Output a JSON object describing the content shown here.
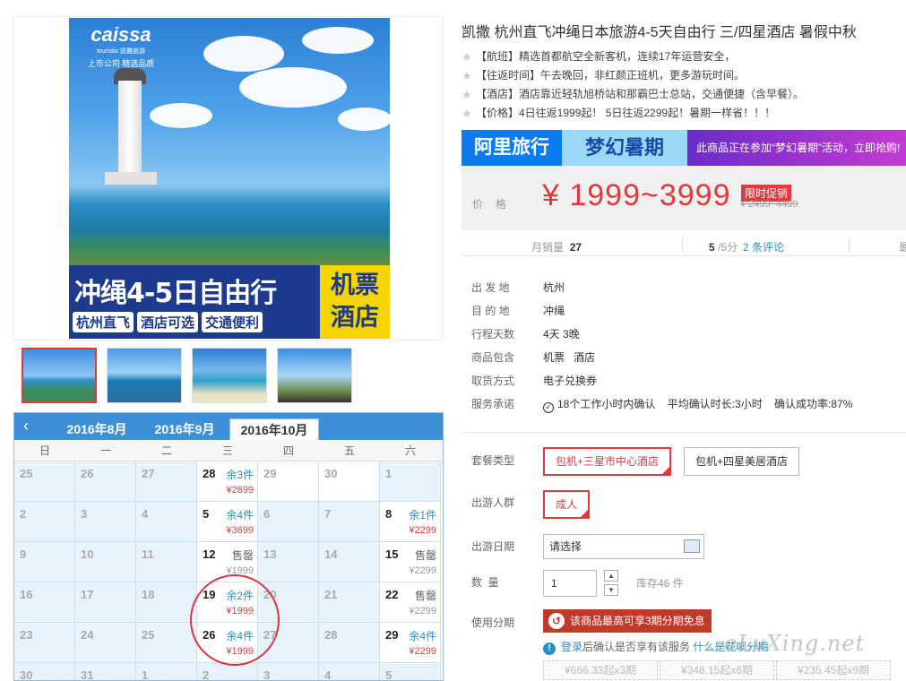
{
  "product": {
    "title": "凯撒 杭州直飞冲绳日本旅游4-5天自由行 三/四星酒店 暑假中秋",
    "features": [
      "【航班】精选首都航空全新客机，连续17年运营安全，",
      "【往返时间】午去晚回，非红颜正班机，更多游玩时间。",
      "【酒店】酒店靠近轻轨旭桥站和那霸巴士总站，交通便捷（含早餐）。",
      "【价格】4日往返1999起！ 5日往返2299起！暑期一样省！！！"
    ]
  },
  "poster": {
    "brand": "caissa",
    "brand_sub": "touristic 凯撒旅游",
    "slogan": "上市公司 精选品质",
    "title": "冲绳4-5日自由行",
    "chips": [
      "杭州直飞",
      "酒店可选",
      "交通便利"
    ],
    "side_line1": "机票",
    "side_line2": "酒店"
  },
  "banner": {
    "brand": "阿里旅行",
    "campaign": "梦幻暑期",
    "promo_text": "此商品正在参加“梦幻暑期”活动，立即抢购!"
  },
  "price": {
    "label": "价格",
    "value": "¥ 1999~3999",
    "badge": "限时促销",
    "original": "¥ 2499~4499"
  },
  "stats": {
    "sales_label": "月销量",
    "sales_value": "27",
    "score_value": "5",
    "score_suffix": "/5分",
    "reviews": "2 条评论",
    "more": "最"
  },
  "info": [
    {
      "k": "出 发 地",
      "v": "杭州"
    },
    {
      "k": "目 的 地",
      "v": "冲绳"
    },
    {
      "k": "行程天数",
      "v": "4天 3晚"
    },
    {
      "k": "商品包含",
      "v": "机票   酒店"
    },
    {
      "k": "取货方式",
      "v": "电子兑换券"
    },
    {
      "k": "服务承诺",
      "v": "18个工作小时内确认    平均确认时长:3小时    确认成功率:87%"
    }
  ],
  "options": {
    "package_label": "套餐类型",
    "package_1": "包机+三星市中心酒店",
    "package_2": "包机+四星美居酒店",
    "people_label": "出游人群",
    "people_1": "成人",
    "date_label": "出游日期",
    "date_placeholder": "请选择",
    "qty_label": "数  量",
    "qty_value": "1",
    "stock": "库存46 件",
    "installment_label": "使用分期",
    "huabei_text": "该商品最高可享3期分期免息",
    "note_link1": "登录",
    "note_text": "后确认是否享有该服务",
    "note_link2": "什么是花呗分期",
    "installments": [
      "¥666.33起x3期",
      "¥348.15起x6期",
      "¥235.45起x9期"
    ]
  },
  "calendar": {
    "months": [
      "2016年8月",
      "2016年9月",
      "2016年10月"
    ],
    "weekdays": [
      "日",
      "一",
      "二",
      "三",
      "四",
      "五",
      "六"
    ],
    "rows": [
      [
        {
          "d": "25"
        },
        {
          "d": "26"
        },
        {
          "d": "27"
        },
        {
          "d": "28",
          "s": "余3件",
          "p": "¥2699"
        },
        {
          "d": "29",
          "w": 1
        },
        {
          "d": "30",
          "w": 1
        },
        {
          "d": "1"
        }
      ],
      [
        {
          "d": "2"
        },
        {
          "d": "3"
        },
        {
          "d": "4"
        },
        {
          "d": "5",
          "s": "余4件",
          "p": "¥3699"
        },
        {
          "d": "6"
        },
        {
          "d": "7"
        },
        {
          "d": "8",
          "s": "余1件",
          "p": "¥2299"
        }
      ],
      [
        {
          "d": "9"
        },
        {
          "d": "10"
        },
        {
          "d": "11"
        },
        {
          "d": "12",
          "s": "售罄",
          "p": "¥1999",
          "sold": 1
        },
        {
          "d": "13"
        },
        {
          "d": "14"
        },
        {
          "d": "15",
          "s": "售罄",
          "p": "¥2299",
          "sold": 1
        }
      ],
      [
        {
          "d": "16"
        },
        {
          "d": "17"
        },
        {
          "d": "18"
        },
        {
          "d": "19",
          "s": "余2件",
          "p": "¥1999"
        },
        {
          "d": "20"
        },
        {
          "d": "21"
        },
        {
          "d": "22",
          "s": "售罄",
          "p": "¥2299",
          "sold": 1
        }
      ],
      [
        {
          "d": "23"
        },
        {
          "d": "24"
        },
        {
          "d": "25"
        },
        {
          "d": "26",
          "s": "余4件",
          "p": "¥1999"
        },
        {
          "d": "27"
        },
        {
          "d": "28"
        },
        {
          "d": "29",
          "s": "余4件",
          "p": "¥2299"
        }
      ],
      [
        {
          "d": "30"
        },
        {
          "d": "31"
        },
        {
          "d": "1"
        },
        {
          "d": "2"
        },
        {
          "d": "3"
        },
        {
          "d": "4"
        },
        {
          "d": "5"
        }
      ]
    ]
  },
  "watermark": "eLvXing.net",
  "colors": {
    "accent": "#e4393c",
    "link": "#2a8ec9",
    "calendar_head": "#3d8fd8"
  }
}
